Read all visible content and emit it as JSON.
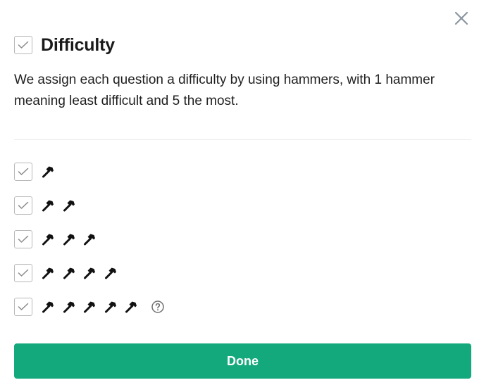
{
  "dialog": {
    "title": "Difficulty",
    "description": "We assign each question a difficulty by using hammers, with 1 hammer meaning least difficult and 5 the most.",
    "title_checked": true,
    "close_icon": "close-icon"
  },
  "options": [
    {
      "hammers": 1,
      "checked": true
    },
    {
      "hammers": 2,
      "checked": true
    },
    {
      "hammers": 3,
      "checked": true
    },
    {
      "hammers": 4,
      "checked": true
    },
    {
      "hammers": 5,
      "checked": true,
      "help_icon": "question-circle-icon"
    }
  ],
  "done_label": "Done",
  "colors": {
    "accent": "#14a97c",
    "checkbox_border": "#b8b8b8",
    "checkmark": "#8a8a8a",
    "close": "#8a96a0",
    "text": "#1a1a1a"
  }
}
